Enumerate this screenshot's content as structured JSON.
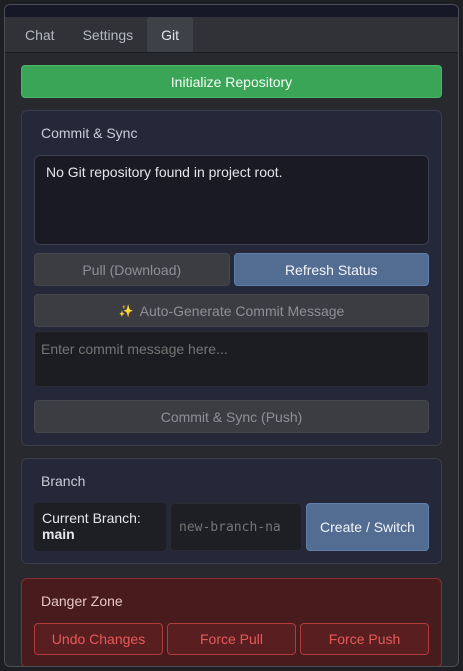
{
  "tabs": [
    {
      "label": "Chat",
      "active": false
    },
    {
      "label": "Settings",
      "active": false
    },
    {
      "label": "Git",
      "active": true
    }
  ],
  "init_button": "Initialize Repository",
  "commit_panel": {
    "title": "Commit & Sync",
    "status_text": "No Git repository found in project root.",
    "pull_button": "Pull (Download)",
    "refresh_button": "Refresh Status",
    "autogen_icon": "sparkles-icon",
    "autogen_button": "Auto-Generate Commit Message",
    "message_placeholder": "Enter commit message here...",
    "commit_button": "Commit & Sync (Push)"
  },
  "branch_panel": {
    "title": "Branch",
    "current_label": "Current Branch:",
    "current_value": "main",
    "new_branch_placeholder": "new-branch-na",
    "create_button": "Create / Switch"
  },
  "danger_panel": {
    "title": "Danger Zone",
    "undo_button": "Undo Changes",
    "force_pull_button": "Force Pull",
    "force_push_button": "Force Push"
  },
  "colors": {
    "accent_green": "#3aa557",
    "accent_blue": "#526d91",
    "danger_red": "#e85a5a"
  }
}
